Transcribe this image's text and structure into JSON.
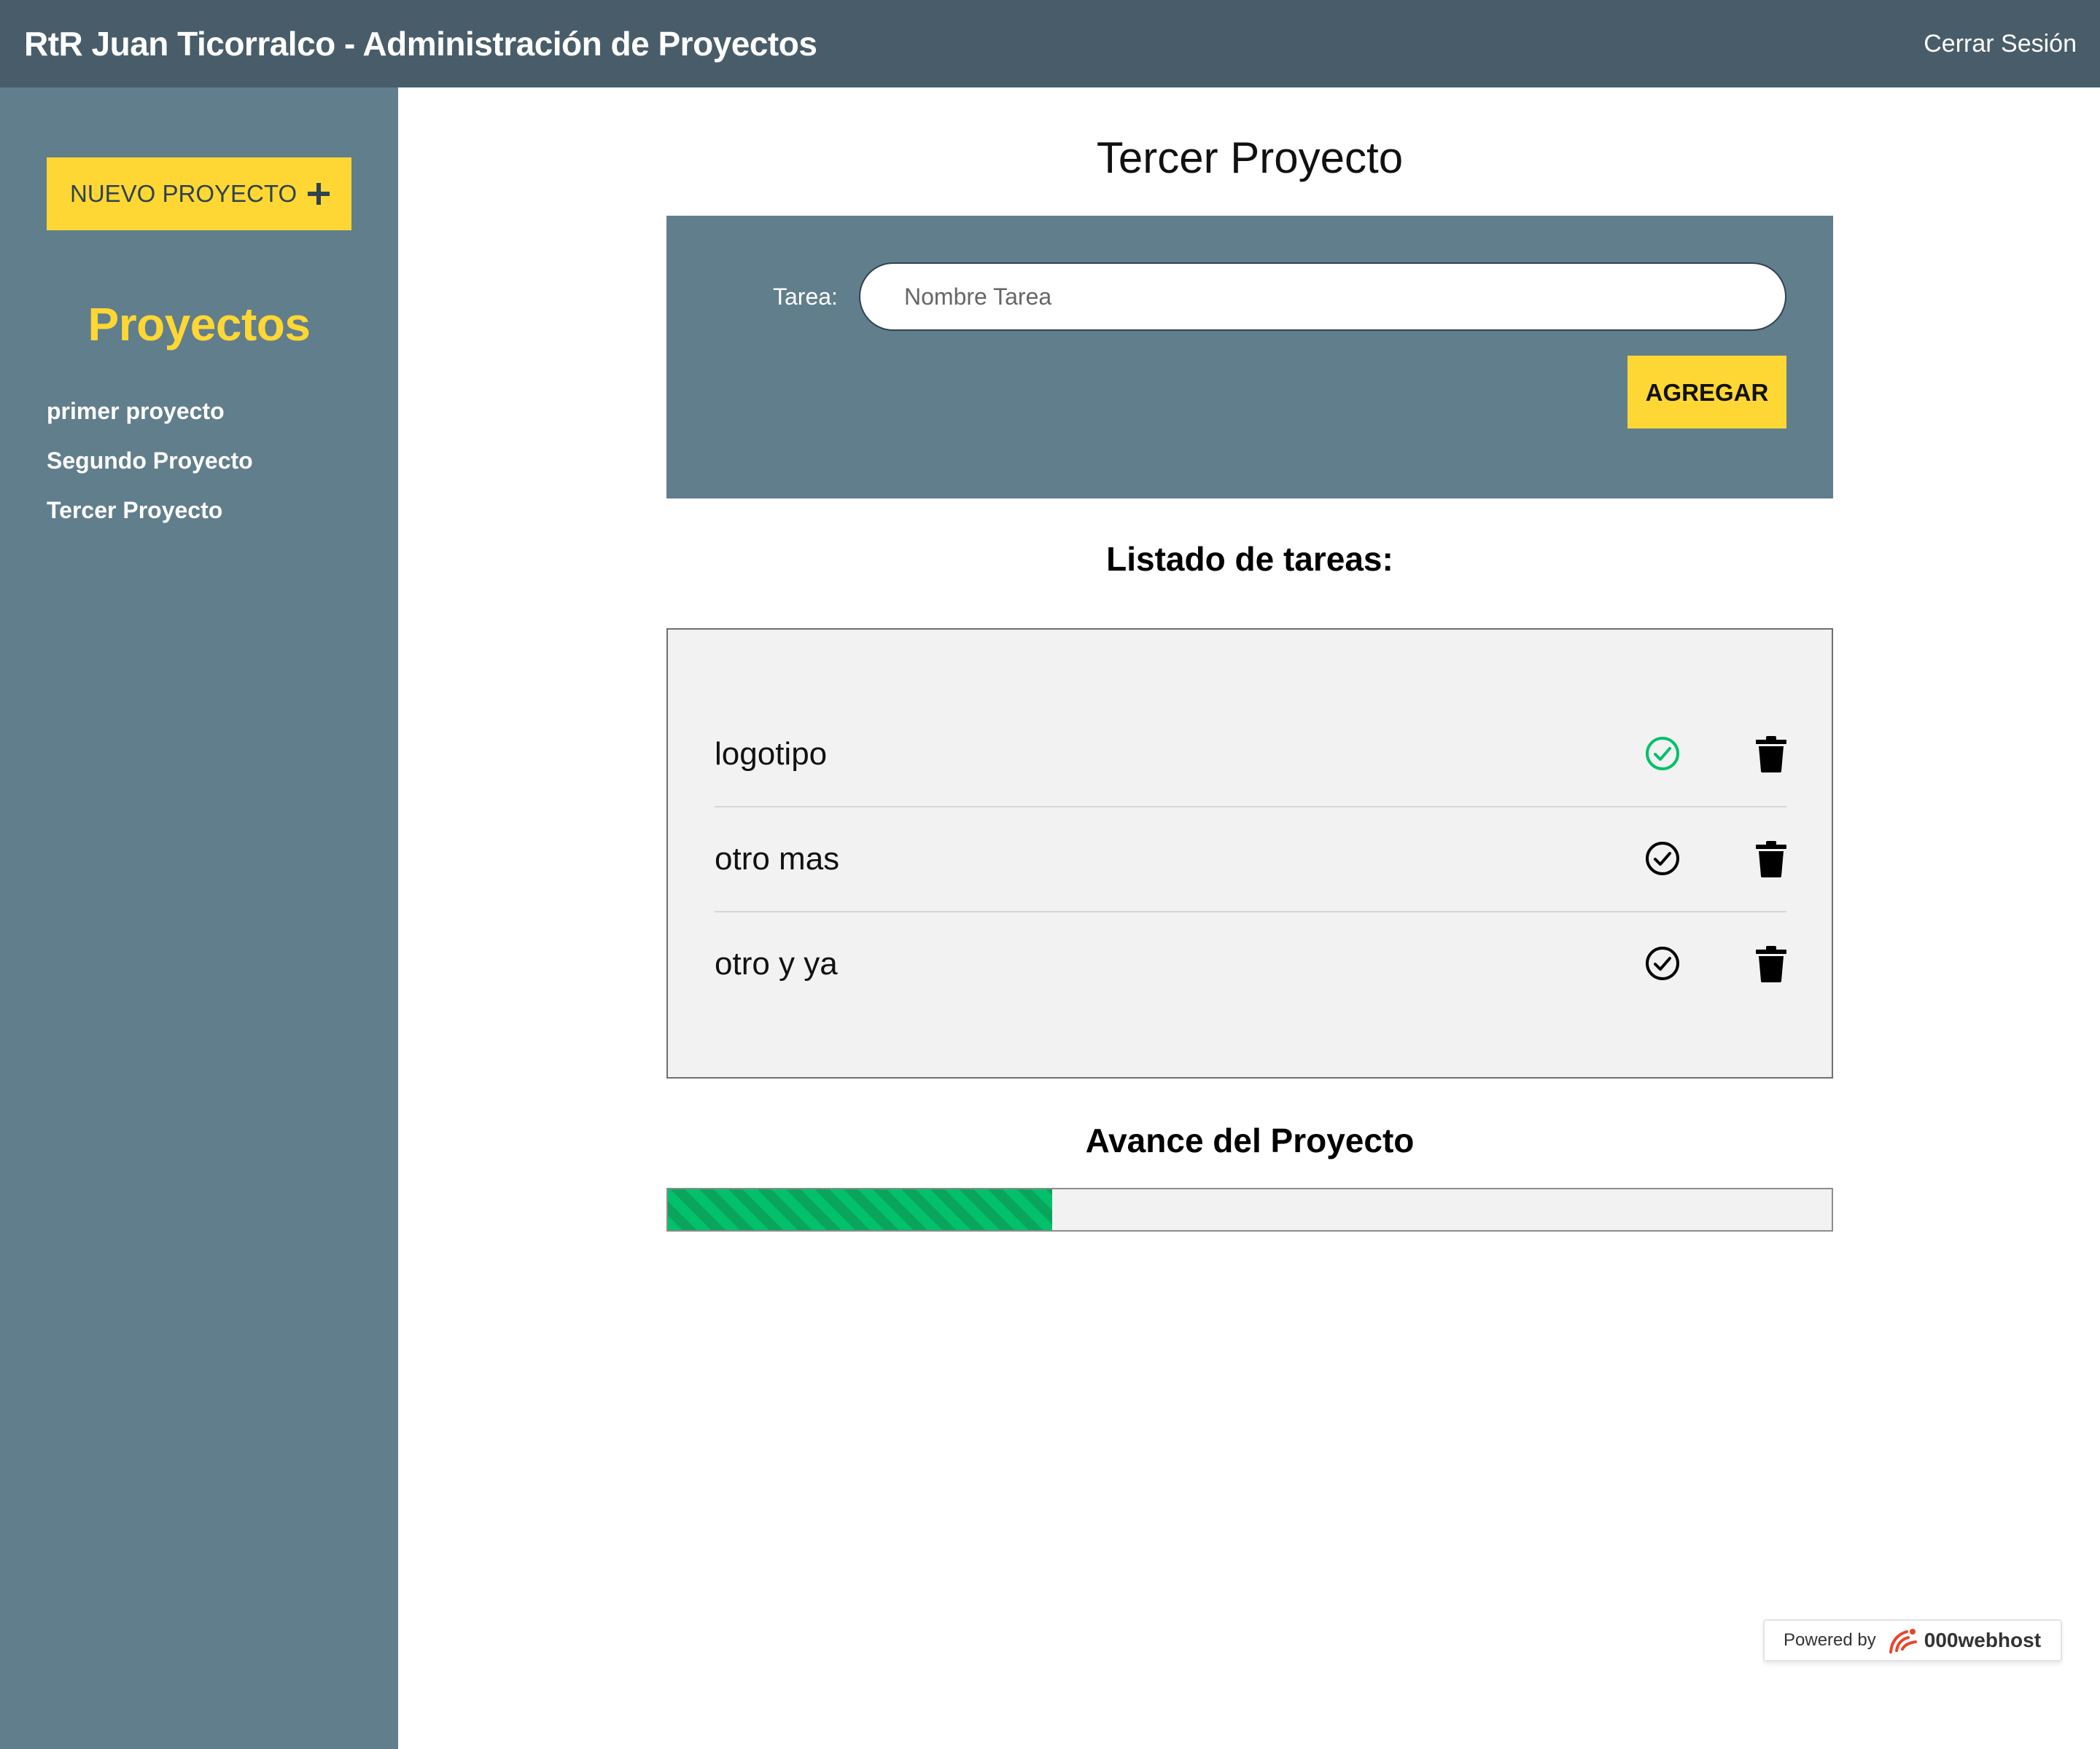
{
  "header": {
    "title": "RtR Juan Ticorralco - Administración de Proyectos",
    "logout_label": "Cerrar Sesión"
  },
  "sidebar": {
    "new_project_label": "NUEVO PROYECTO",
    "new_project_icon": "plus-icon",
    "heading": "Proyectos",
    "projects": [
      {
        "label": "primer proyecto"
      },
      {
        "label": "Segundo Proyecto"
      },
      {
        "label": "Tercer Proyecto"
      }
    ]
  },
  "main": {
    "project_title": "Tercer Proyecto",
    "form": {
      "task_label": "Tarea:",
      "task_placeholder": "Nombre Tarea",
      "task_value": "",
      "add_label": "AGREGAR"
    },
    "list_heading": "Listado de tareas:",
    "tasks": [
      {
        "name": "logotipo",
        "completed": true,
        "status_icon": "check-circle-icon",
        "delete_icon": "trash-icon"
      },
      {
        "name": "otro mas",
        "completed": false,
        "status_icon": "check-circle-icon",
        "delete_icon": "trash-icon"
      },
      {
        "name": "otro y ya",
        "completed": false,
        "status_icon": "check-circle-icon",
        "delete_icon": "trash-icon"
      }
    ],
    "progress_heading": "Avance del Proyecto",
    "progress_fraction": 0.33
  },
  "badge": {
    "powered_by": "Powered by",
    "brand": "000webhost"
  },
  "colors": {
    "topbar": "#485d69",
    "sidebar": "#617e8c",
    "accent_yellow": "#fed734",
    "complete_green": "#03c06b",
    "panel_gray": "#f2f2f2"
  }
}
